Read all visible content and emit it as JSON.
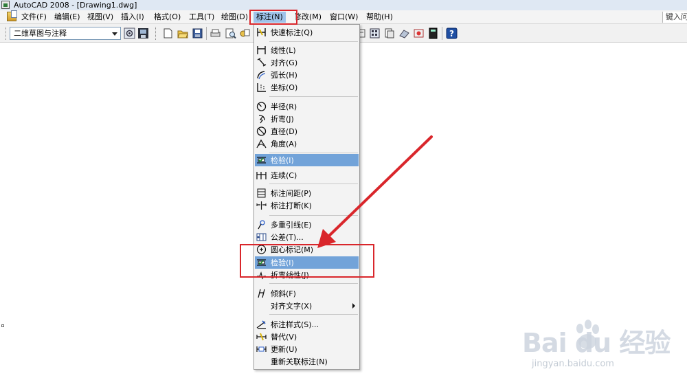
{
  "window": {
    "title": "AutoCAD 2008 - [Drawing1.dwg]"
  },
  "menubar": {
    "items": [
      {
        "label": "文件(F)"
      },
      {
        "label": "编辑(E)"
      },
      {
        "label": "视图(V)"
      },
      {
        "label": "插入(I)"
      },
      {
        "label": "格式(O)"
      },
      {
        "label": "工具(T)"
      },
      {
        "label": "绘图(D)"
      },
      {
        "label": "标注(N)"
      },
      {
        "label": "修改(M)"
      },
      {
        "label": "窗口(W)"
      },
      {
        "label": "帮助(H)"
      }
    ],
    "help_search": "键入问"
  },
  "toolbar": {
    "workspace_value": "二维草图与注释"
  },
  "dimension_menu": {
    "items": [
      {
        "label": "快速标注(Q)",
        "icon": "quick-dimension-icon"
      },
      {
        "label": "线性(L)",
        "icon": "linear-dimension-icon"
      },
      {
        "label": "对齐(G)",
        "icon": "aligned-dimension-icon"
      },
      {
        "label": "弧长(H)",
        "icon": "arc-length-icon"
      },
      {
        "label": "坐标(O)",
        "icon": "ordinate-icon"
      },
      {
        "label": "半径(R)",
        "icon": "radius-icon"
      },
      {
        "label": "折弯(J)",
        "icon": "jogged-icon"
      },
      {
        "label": "直径(D)",
        "icon": "diameter-icon"
      },
      {
        "label": "角度(A)",
        "icon": "angular-icon"
      },
      {
        "label": "检验(I)",
        "icon": "inspection-icon"
      },
      {
        "label": "连续(C)",
        "icon": "continue-icon"
      },
      {
        "label": "标注间距(P)",
        "icon": "dimension-space-icon"
      },
      {
        "label": "标注打断(K)",
        "icon": "dimension-break-icon"
      },
      {
        "label": "多重引线(E)",
        "icon": "multileader-icon"
      },
      {
        "label": "公差(T)...",
        "icon": "tolerance-icon"
      },
      {
        "label": "圆心标记(M)",
        "icon": "center-mark-icon"
      },
      {
        "label": "检验(I)",
        "icon": "inspection-icon"
      },
      {
        "label": "折弯线性(J)",
        "icon": "jogged-linear-icon"
      },
      {
        "label": "倾斜(F)",
        "icon": "oblique-icon"
      },
      {
        "label": "对齐文字(X)",
        "icon": ""
      },
      {
        "label": "标注样式(S)...",
        "icon": "dimension-style-icon"
      },
      {
        "label": "替代(V)",
        "icon": "override-icon"
      },
      {
        "label": "更新(U)",
        "icon": "update-icon"
      },
      {
        "label": "重新关联标注(N)",
        "icon": ""
      }
    ]
  },
  "watermark": {
    "main": "Bai du 经验",
    "sub": "jingyan.baidu.com"
  },
  "colors": {
    "highlight": "#72a3d9",
    "annotation_red": "#d9262b",
    "menu_background": "#f3f3f3"
  }
}
